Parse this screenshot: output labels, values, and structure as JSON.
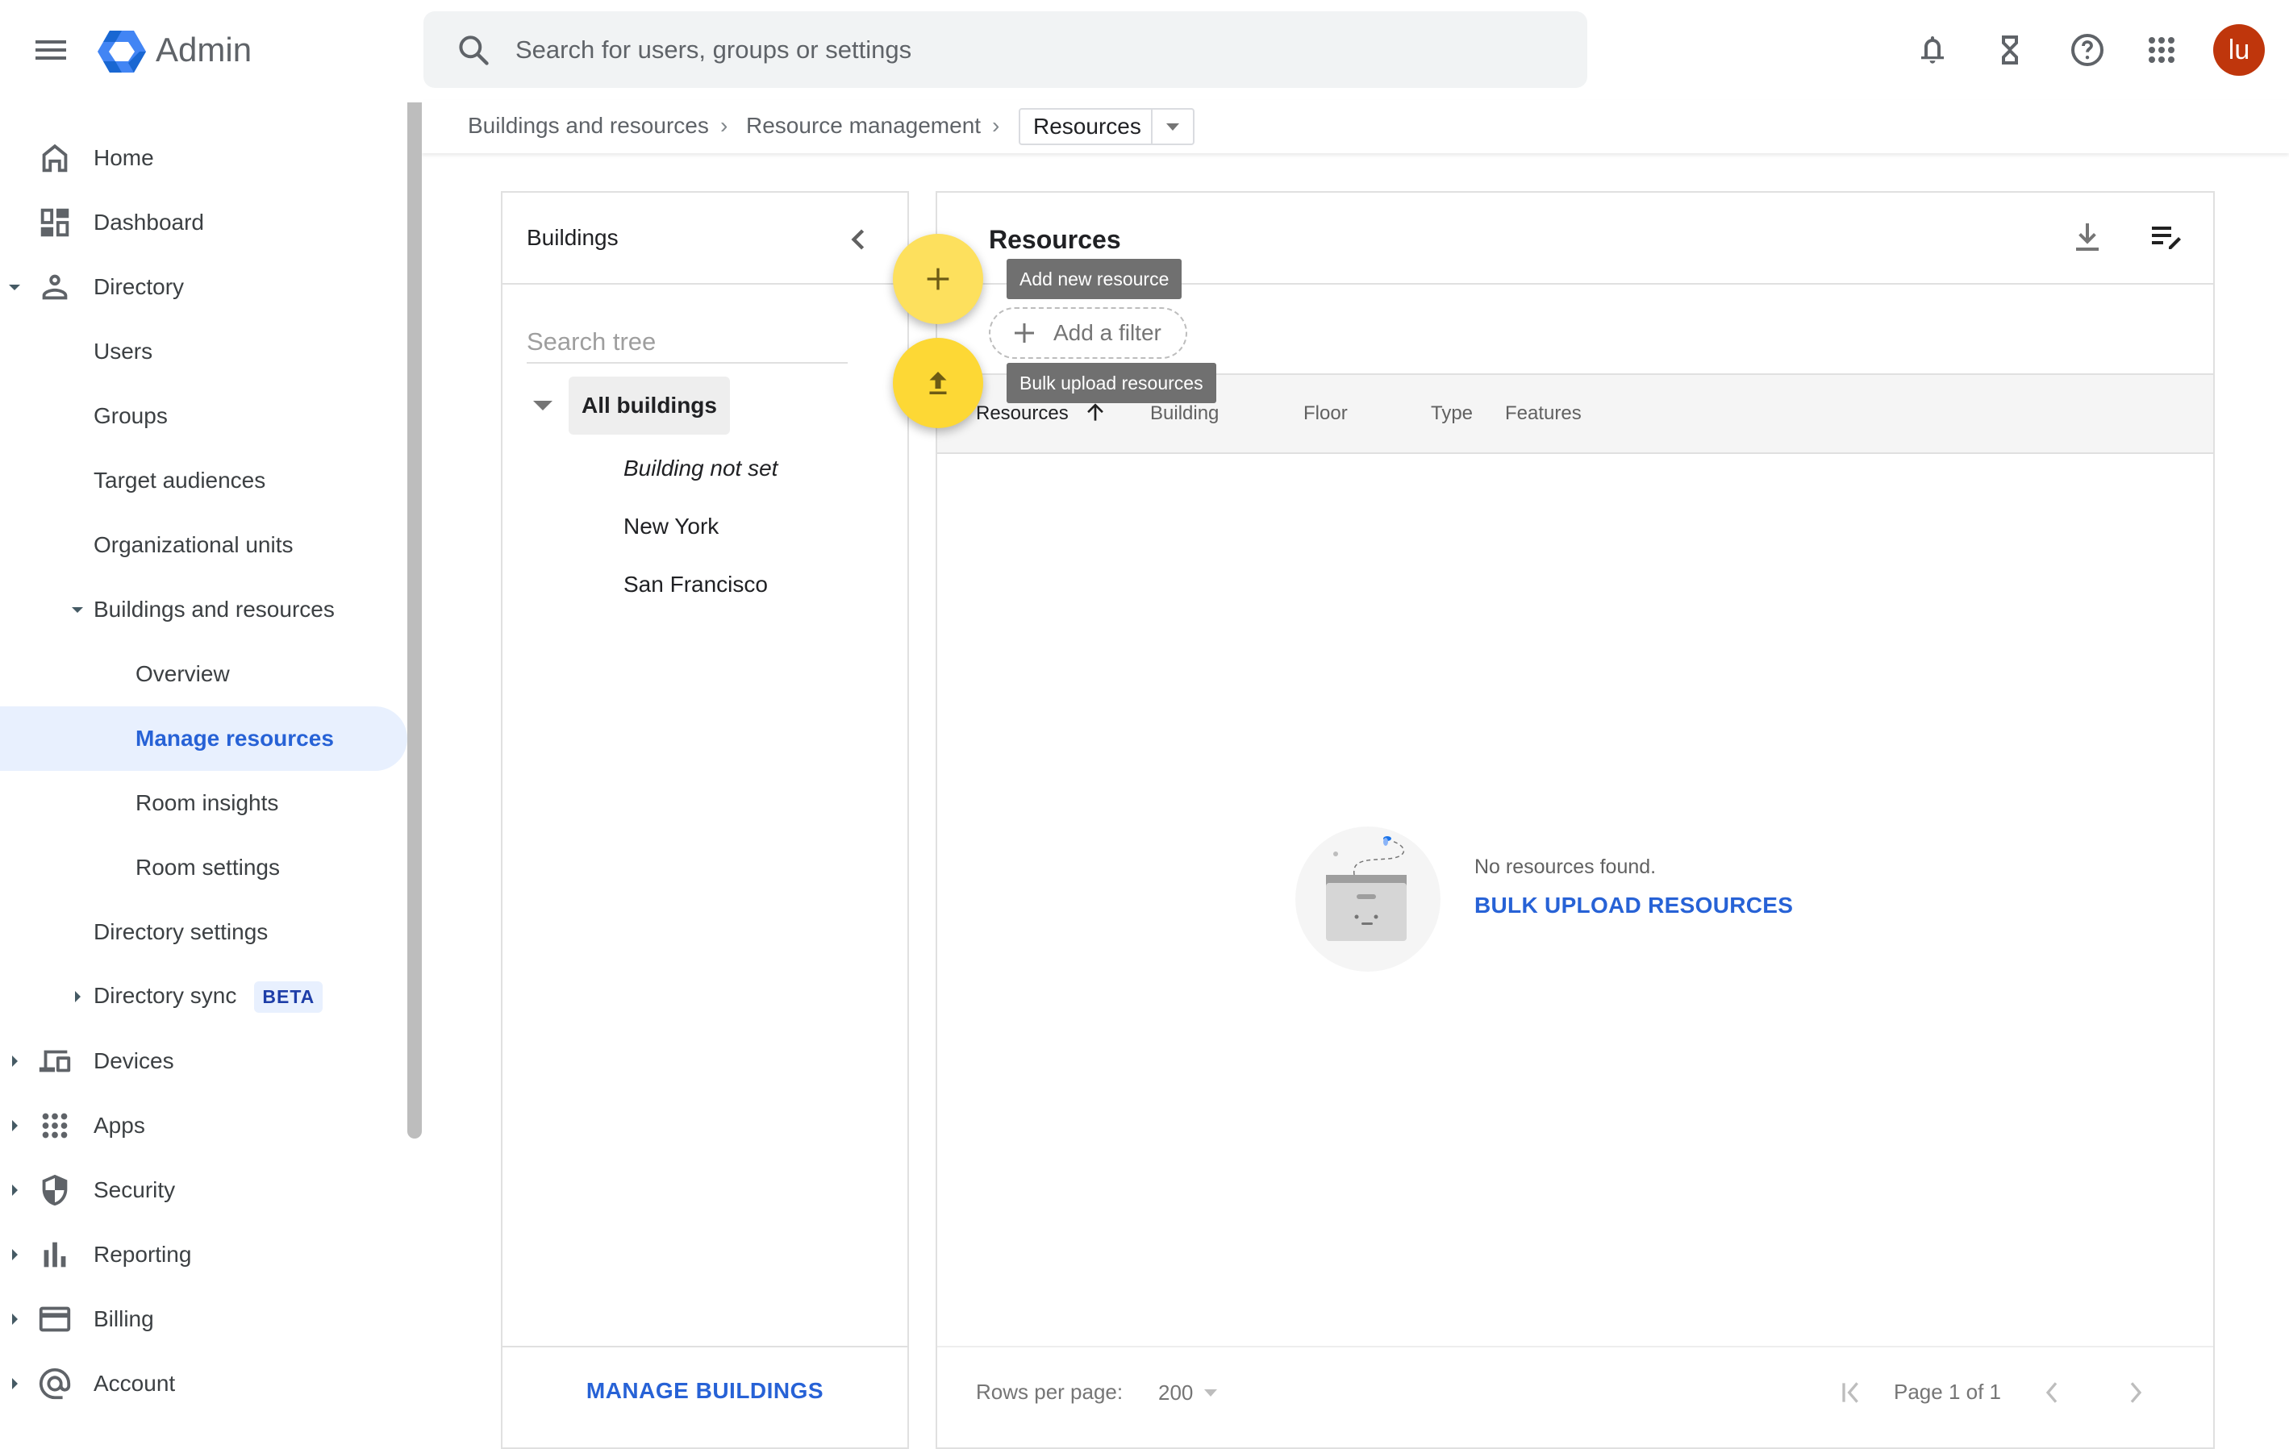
{
  "header": {
    "app_title": "Admin",
    "search_placeholder": "Search for users, groups or settings",
    "avatar_initials": "lu",
    "avatar_color": "#bf360c",
    "icons": [
      "menu-icon",
      "admin-logo",
      "search-icon",
      "notifications-icon",
      "tasks-hourglass-icon",
      "help-icon",
      "apps-grid-icon"
    ]
  },
  "breadcrumb": {
    "items": [
      "Buildings and resources",
      "Resource management"
    ],
    "current": "Resources"
  },
  "sidebar": {
    "items": [
      {
        "label": "Home",
        "icon": "home-icon",
        "level": 0
      },
      {
        "label": "Dashboard",
        "icon": "dashboard-icon",
        "level": 0
      },
      {
        "label": "Directory",
        "icon": "person-icon",
        "level": 0,
        "expanded": true
      },
      {
        "label": "Users",
        "level": 1
      },
      {
        "label": "Groups",
        "level": 1
      },
      {
        "label": "Target audiences",
        "level": 1
      },
      {
        "label": "Organizational units",
        "level": 1
      },
      {
        "label": "Buildings and resources",
        "level": 1,
        "expanded": true
      },
      {
        "label": "Overview",
        "level": 2
      },
      {
        "label": "Manage resources",
        "level": 2,
        "active": true
      },
      {
        "label": "Room insights",
        "level": 2
      },
      {
        "label": "Room settings",
        "level": 2
      },
      {
        "label": "Directory settings",
        "level": 1
      },
      {
        "label": "Directory sync",
        "level": 1,
        "collapsed": true,
        "badge": "BETA"
      },
      {
        "label": "Devices",
        "icon": "devices-icon",
        "level": 0,
        "collapsed": true
      },
      {
        "label": "Apps",
        "icon": "apps-icon",
        "level": 0,
        "collapsed": true
      },
      {
        "label": "Security",
        "icon": "security-shield-icon",
        "level": 0,
        "collapsed": true
      },
      {
        "label": "Reporting",
        "icon": "reporting-bar-chart-icon",
        "level": 0,
        "collapsed": true
      },
      {
        "label": "Billing",
        "icon": "billing-card-icon",
        "level": 0,
        "collapsed": true
      },
      {
        "label": "Account",
        "icon": "account-at-icon",
        "level": 0,
        "collapsed": true
      }
    ]
  },
  "buildings_panel": {
    "title": "Buildings",
    "search_placeholder": "Search tree",
    "tree_root": "All buildings",
    "tree_children": [
      "Building not set",
      "New York",
      "San Francisco"
    ],
    "footer_button": "MANAGE BUILDINGS"
  },
  "resources_panel": {
    "title": "Resources",
    "add_filter_label": "Add a filter",
    "columns": [
      "Resources",
      "Building",
      "Floor",
      "Type",
      "Features"
    ],
    "sort_column": "Resources",
    "sort_direction": "ascending",
    "empty_message": "No resources found.",
    "empty_action": "BULK UPLOAD RESOURCES",
    "rows_per_page_label": "Rows per page:",
    "rows_per_page_value": "200",
    "page_label": "Page 1 of 1"
  },
  "fabs": {
    "add_tooltip": "Add new resource",
    "upload_tooltip": "Bulk upload resources",
    "color_add": "#fde05d",
    "color_upload": "#fdd835"
  },
  "colors": {
    "accent": "#2762d6",
    "active_nav_bg": "#e8f0fe"
  }
}
